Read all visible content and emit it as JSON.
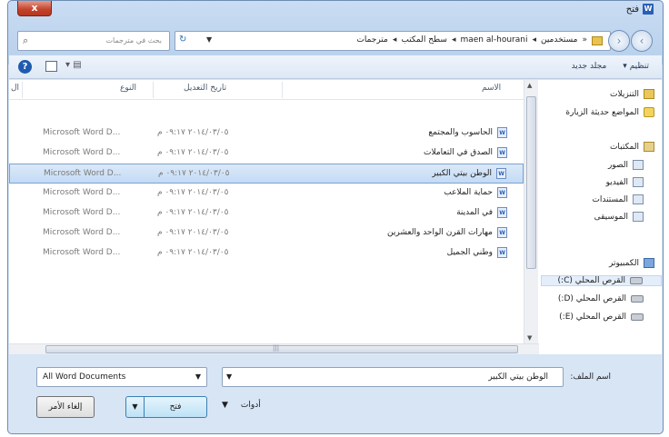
{
  "window": {
    "title": "فتح",
    "close_label": "x"
  },
  "address": {
    "search_placeholder": "بحث في مترجمات",
    "breadcrumbs": [
      "مستخدمين",
      "maen al-hourani",
      "سطح المكتب",
      "مترجمات"
    ],
    "separator": "◂"
  },
  "toolbar": {
    "organize_label": "تنظيم",
    "new_folder_label": "مجلد جديد"
  },
  "columns": {
    "name": "الاسم",
    "date_modified": "تاريخ التعديل",
    "type": "النوع",
    "size": "ال"
  },
  "files": [
    {
      "name": "الحاسوب والمجتمع",
      "date": "٢٠١٤/٠٣/٠٥ ٠٩:١٧ م",
      "type": "Microsoft Word D..."
    },
    {
      "name": "الصدق في التعاملات",
      "date": "٢٠١٤/٠٣/٠٥ ٠٩:١٧ م",
      "type": "Microsoft Word D..."
    },
    {
      "name": "الوطن بيتي الكبير",
      "date": "٢٠١٤/٠٣/٠٥ ٠٩:١٧ م",
      "type": "Microsoft Word D...",
      "selected": true
    },
    {
      "name": "حماية الملاعب",
      "date": "٢٠١٤/٠٣/٠٥ ٠٩:١٧ م",
      "type": "Microsoft Word D..."
    },
    {
      "name": "في المدينة",
      "date": "٢٠١٤/٠٣/٠٥ ٠٩:١٧ م",
      "type": "Microsoft Word D..."
    },
    {
      "name": "مهارات القرن الواحد والعشرين",
      "date": "٢٠١٤/٠٣/٠٥ ٠٩:١٧ م",
      "type": "Microsoft Word D..."
    },
    {
      "name": "وطني الجميل",
      "date": "٢٠١٤/٠٣/٠٥ ٠٩:١٧ م",
      "type": "Microsoft Word D..."
    }
  ],
  "nav": {
    "downloads": "التنزيلات",
    "recent_places": "المواضع حديثة الزيارة",
    "libraries": "المكتبات",
    "pictures": "الصور",
    "videos": "الفيديو",
    "documents": "المستندات",
    "music": "الموسيقى",
    "computer": "الكمبيوتر",
    "drive_c": "القرص المحلي (C:)",
    "drive_d": "القرص المحلي (D:)",
    "drive_e": "القرص المحلي (E:)"
  },
  "bottom": {
    "filename_label": "اسم الملف:",
    "filename_value": "الوطن بيتي الكبير",
    "filter_value": "All Word Documents",
    "open_label": "فتح",
    "cancel_label": "إلغاء الأمر",
    "tools_label": "أدوات"
  },
  "colors": {
    "selection": "#c3dbf5",
    "window_chrome": "#b8d0ec"
  }
}
